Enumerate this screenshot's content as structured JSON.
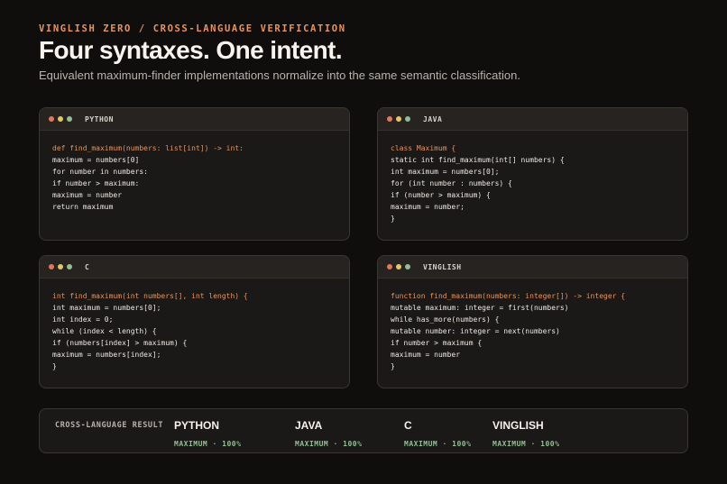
{
  "header": {
    "eyebrow": "VINGLISH ZERO / CROSS-LANGUAGE VERIFICATION",
    "title": "Four syntaxes. One intent.",
    "subtitle": "Equivalent maximum-finder implementations normalize into the same semantic classification."
  },
  "panels": [
    {
      "lang": "PYTHON",
      "lines": [
        "def find_maximum(numbers: list[int]) -> int:",
        "maximum = numbers[0]",
        "for number in numbers:",
        "if number > maximum:",
        "maximum = number",
        "return maximum"
      ]
    },
    {
      "lang": "JAVA",
      "lines": [
        "class Maximum {",
        "static int find_maximum(int[] numbers) {",
        "int maximum = numbers[0];",
        "for (int number : numbers) {",
        "if (number > maximum) {",
        "maximum = number;",
        "}"
      ]
    },
    {
      "lang": "C",
      "lines": [
        "int find_maximum(int numbers[], int length) {",
        "int maximum = numbers[0];",
        "int index = 0;",
        "while (index < length) {",
        "if (numbers[index] > maximum) {",
        "maximum = numbers[index];",
        "}"
      ]
    },
    {
      "lang": "VINGLISH",
      "lines": [
        "function find_maximum(numbers: integer[]) -> integer {",
        "mutable maximum: integer = first(numbers)",
        "while has_more(numbers) {",
        "mutable number: integer = next(numbers)",
        "if number > maximum {",
        "maximum = number",
        "}"
      ]
    }
  ],
  "result": {
    "label": "CROSS-LANGUAGE RESULT",
    "items": [
      {
        "name": "PYTHON",
        "value": "MAXIMUM · 100%"
      },
      {
        "name": "JAVA",
        "value": "MAXIMUM · 100%"
      },
      {
        "name": "C",
        "value": "MAXIMUM · 100%"
      },
      {
        "name": "VINGLISH",
        "value": "MAXIMUM · 100%"
      }
    ]
  },
  "colors": {
    "accent": "#e8935a",
    "success": "#8fbf92",
    "background": "#0f0e0d",
    "panel": "#1b1917"
  }
}
